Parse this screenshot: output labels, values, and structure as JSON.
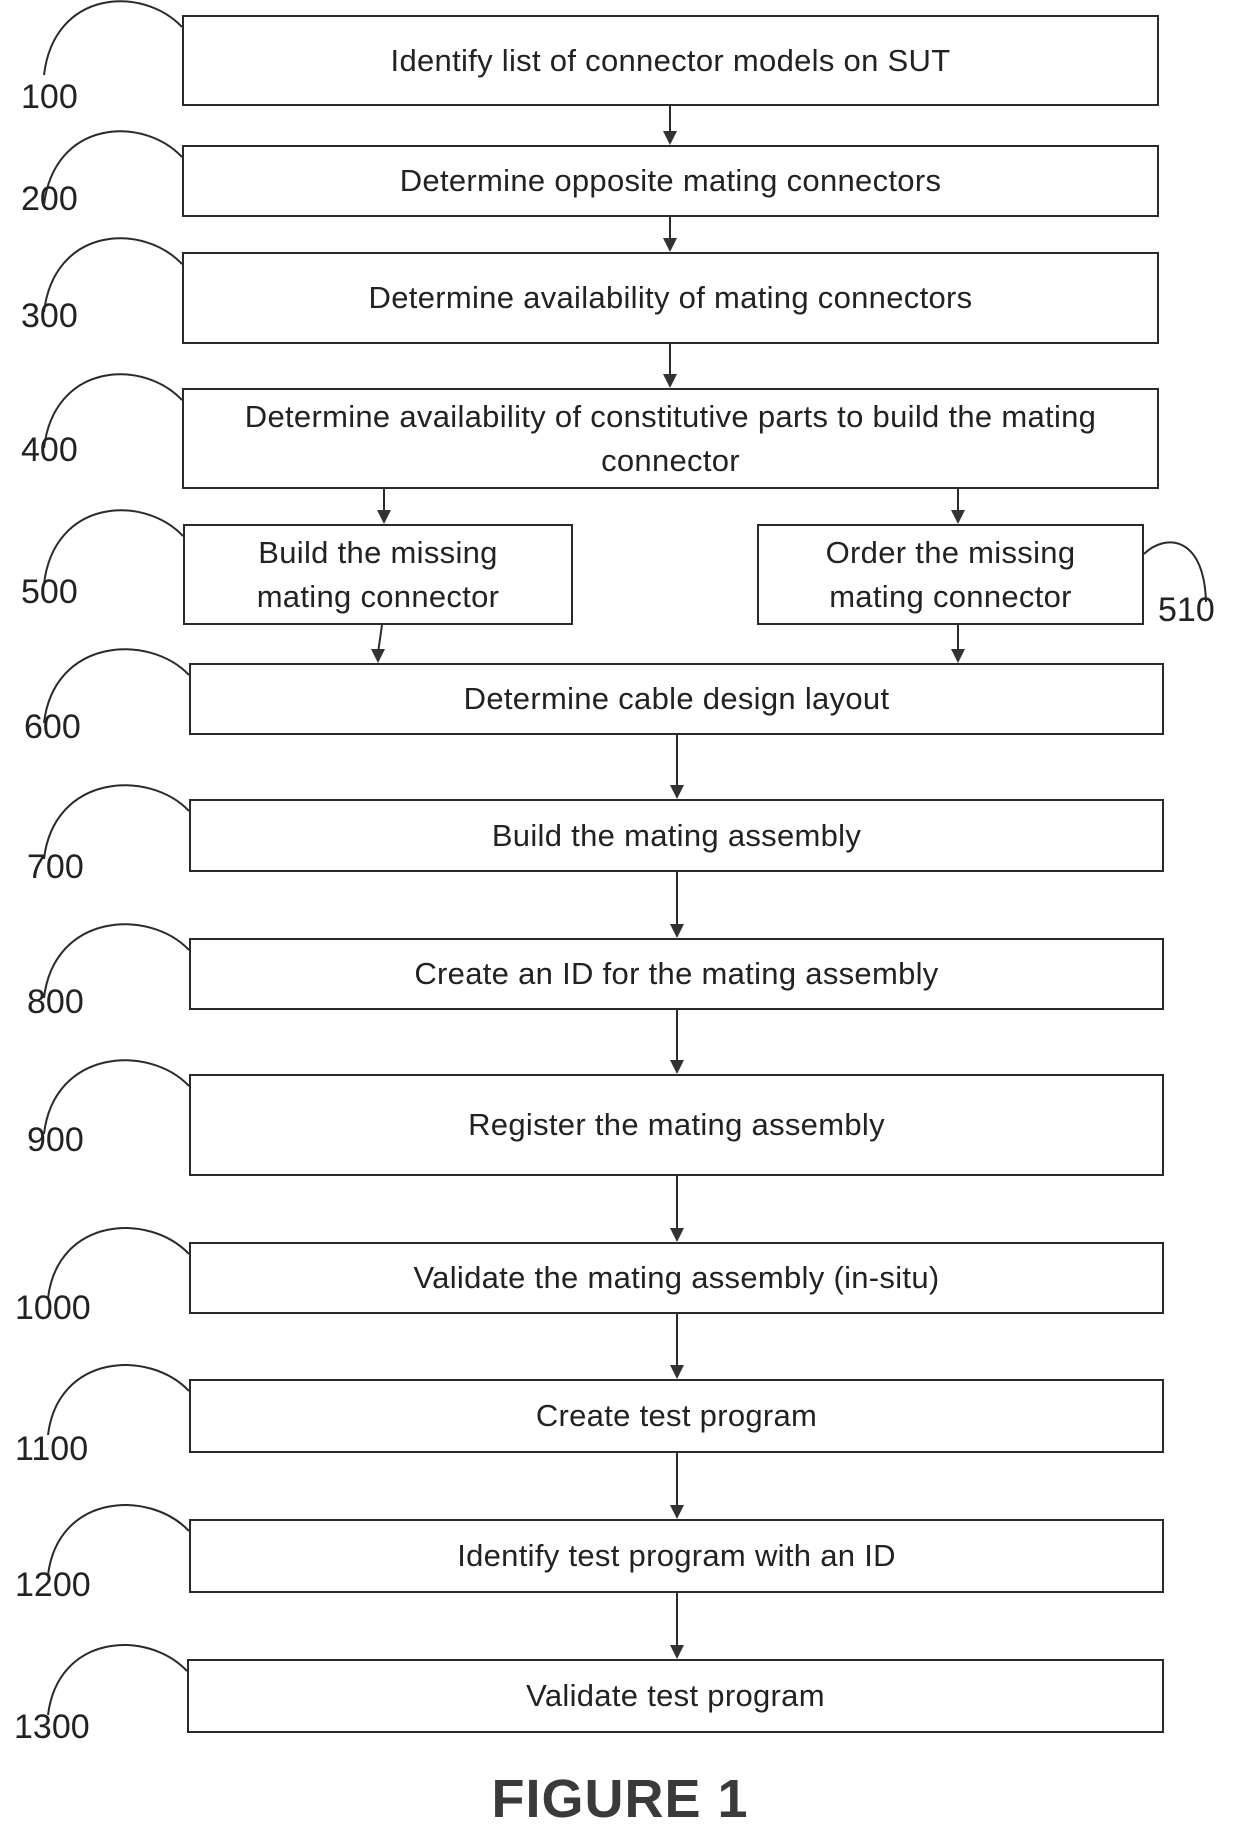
{
  "figure": {
    "caption": "FIGURE 1",
    "steps": [
      {
        "ref": "100",
        "text": "Identify list of connector models on SUT"
      },
      {
        "ref": "200",
        "text": "Determine opposite mating connectors"
      },
      {
        "ref": "300",
        "text": "Determine availability of mating connectors"
      },
      {
        "ref": "400",
        "text": "Determine availability of constitutive parts to build the mating connector"
      },
      {
        "ref": "500",
        "text": "Build the missing mating connector"
      },
      {
        "ref": "510",
        "text": "Order the missing mating connector"
      },
      {
        "ref": "600",
        "text": "Determine cable design layout"
      },
      {
        "ref": "700",
        "text": "Build the mating assembly"
      },
      {
        "ref": "800",
        "text": "Create an ID for the mating assembly"
      },
      {
        "ref": "900",
        "text": "Register the mating assembly"
      },
      {
        "ref": "1000",
        "text": "Validate the mating assembly (in-situ)"
      },
      {
        "ref": "1100",
        "text": "Create test program"
      },
      {
        "ref": "1200",
        "text": "Identify test program with an ID"
      },
      {
        "ref": "1300",
        "text": "Validate test program"
      }
    ],
    "edges": [
      {
        "from": "100",
        "to": "200"
      },
      {
        "from": "200",
        "to": "300"
      },
      {
        "from": "300",
        "to": "400"
      },
      {
        "from": "400",
        "to": "500"
      },
      {
        "from": "400",
        "to": "510"
      },
      {
        "from": "500",
        "to": "600"
      },
      {
        "from": "510",
        "to": "600"
      },
      {
        "from": "600",
        "to": "700"
      },
      {
        "from": "700",
        "to": "800"
      },
      {
        "from": "800",
        "to": "900"
      },
      {
        "from": "900",
        "to": "1000"
      },
      {
        "from": "1000",
        "to": "1100"
      },
      {
        "from": "1100",
        "to": "1200"
      },
      {
        "from": "1200",
        "to": "1300"
      }
    ]
  }
}
